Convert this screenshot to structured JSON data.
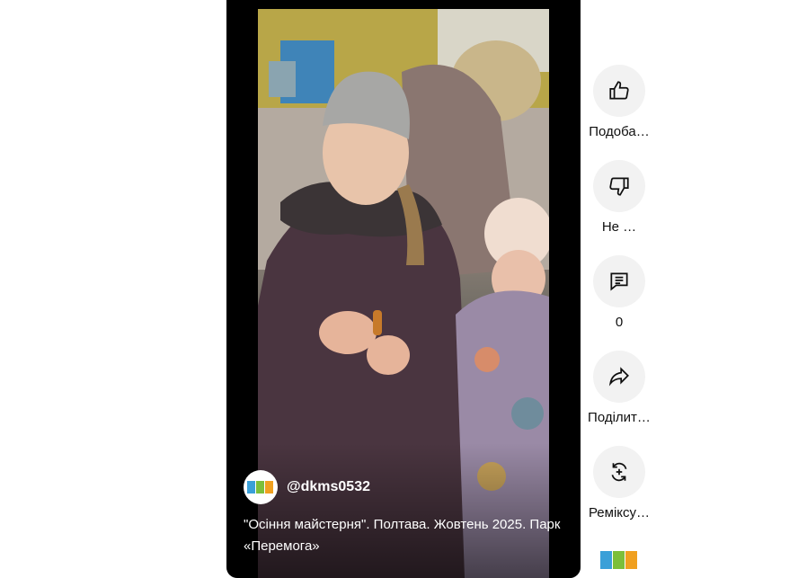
{
  "video": {
    "channel_handle": "@dkms0532",
    "title": "\"Осіння майстерня\". Полтава. Жовтень 2025. Парк «Перемога»"
  },
  "actions": [
    {
      "name": "like",
      "icon": "thumbs-up-icon",
      "label": "Подоба…"
    },
    {
      "name": "dislike",
      "icon": "thumbs-down-icon",
      "label": "Не …"
    },
    {
      "name": "comments",
      "icon": "comment-icon",
      "label": "0"
    },
    {
      "name": "share",
      "icon": "share-icon",
      "label": "Поділит…"
    },
    {
      "name": "remix",
      "icon": "remix-icon",
      "label": "Реміксу…"
    }
  ],
  "colors": {
    "button_bg": "#f2f2f2",
    "text": "#0f0f0f",
    "player_bg": "#000000"
  }
}
